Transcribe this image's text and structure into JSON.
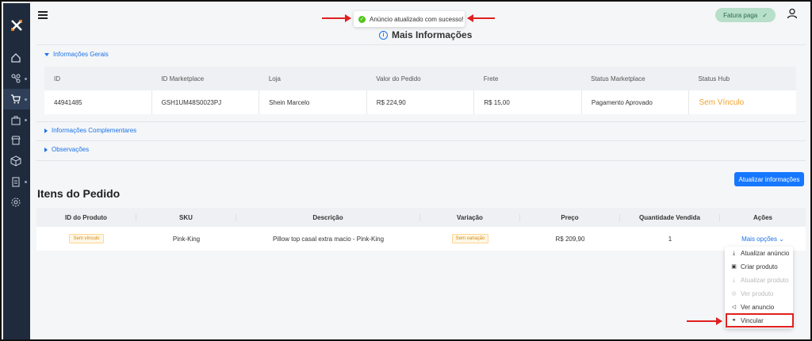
{
  "toast": {
    "message": "Anúncio atualizado com sucesso!"
  },
  "header": {
    "fatura_label": "Fatura paga"
  },
  "section": {
    "title": "Mais Informações"
  },
  "collapsibles": {
    "geral": "Informações Gerais",
    "complementares": "Informações Complementares",
    "observacoes": "Observações"
  },
  "info_table": {
    "headers": [
      "ID",
      "ID Marketplace",
      "Loja",
      "Valor do Pedido",
      "Frete",
      "Status Marketplace",
      "Status Hub"
    ],
    "values": [
      "44941485",
      "GSH1UM48S0023PJ",
      "Shein Marcelo",
      "R$ 224,90",
      "R$ 15,00",
      "Pagamento Aprovado",
      "Sem Vínculo"
    ]
  },
  "update_button": "Atualizar informações",
  "itens": {
    "title": "Itens do Pedido",
    "headers": [
      "ID do Produto",
      "SKU",
      "Descrição",
      "Variação",
      "Preço",
      "Quantidade Vendida",
      "Ações"
    ],
    "row": {
      "id_tag": "Sem vínculo",
      "sku": "Pink-King",
      "descricao": "Pillow top casal extra macio - Pink-King",
      "variacao_tag": "Sem variação",
      "preco": "R$ 209,90",
      "quantidade": "1",
      "acoes": "Mais opções"
    }
  },
  "dropdown": {
    "items": [
      "Atualizar anúncio",
      "Criar produto",
      "Atualizar produto",
      "Ver produto",
      "Ver anuncio",
      "Vincular"
    ]
  },
  "colors": {
    "primary": "#1677ff",
    "sidebar": "#1f2b3d",
    "warning": "#f0a22e",
    "annotation": "#e02020",
    "success": "#52c41a"
  }
}
